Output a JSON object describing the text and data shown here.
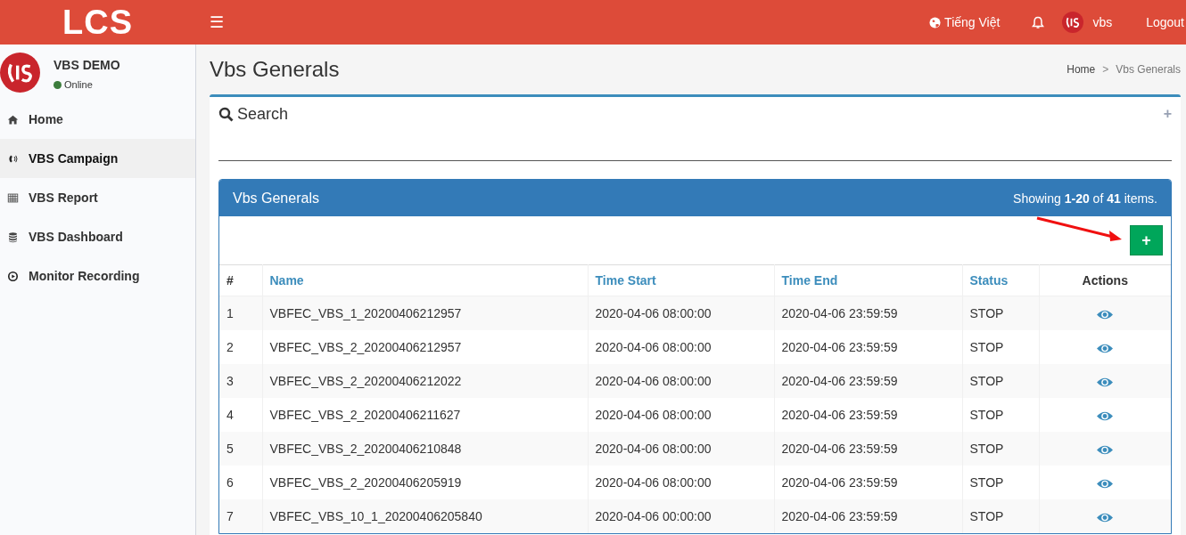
{
  "header": {
    "logo": "LCS",
    "menu_icon": "☰",
    "language": "Tiếng Việt",
    "user": "vbs",
    "logout": "Logout"
  },
  "sidebar": {
    "user_name": "VBS DEMO",
    "status": "Online",
    "items": [
      {
        "label": "Home",
        "selected": false
      },
      {
        "label": "VBS Campaign",
        "selected": true
      },
      {
        "label": "VBS Report",
        "selected": false
      },
      {
        "label": "VBS Dashboard",
        "selected": false
      },
      {
        "label": "Monitor Recording",
        "selected": false
      }
    ]
  },
  "page": {
    "title": "Vbs Generals",
    "breadcrumb": [
      {
        "label": "Home",
        "kind": "link"
      },
      {
        "label": "Vbs Generals",
        "kind": "current"
      }
    ],
    "breadcrumb_separator": ">"
  },
  "search_box": {
    "title": "Search",
    "toggle": "+"
  },
  "panel": {
    "title": "Vbs Generals",
    "summary": "Showing **1-20** of **41** items.",
    "add_button": "+"
  },
  "table": {
    "columns": [
      {
        "label": "#",
        "kind": "plain"
      },
      {
        "label": "Name",
        "kind": "sortable"
      },
      {
        "label": "Time Start",
        "kind": "sortable"
      },
      {
        "label": "Time End",
        "kind": "sortable"
      },
      {
        "label": "Status",
        "kind": "sortable"
      },
      {
        "label": "Actions",
        "kind": "center"
      }
    ],
    "rows": [
      [
        "1",
        "VBFEC_VBS_1_20200406212957",
        "2020-04-06 08:00:00",
        "2020-04-06 23:59:59",
        "STOP"
      ],
      [
        "2",
        "VBFEC_VBS_2_20200406212957",
        "2020-04-06 08:00:00",
        "2020-04-06 23:59:59",
        "STOP"
      ],
      [
        "3",
        "VBFEC_VBS_2_20200406212022",
        "2020-04-06 08:00:00",
        "2020-04-06 23:59:59",
        "STOP"
      ],
      [
        "4",
        "VBFEC_VBS_2_20200406211627",
        "2020-04-06 08:00:00",
        "2020-04-06 23:59:59",
        "STOP"
      ],
      [
        "5",
        "VBFEC_VBS_2_20200406210848",
        "2020-04-06 08:00:00",
        "2020-04-06 23:59:59",
        "STOP"
      ],
      [
        "6",
        "VBFEC_VBS_2_20200406205919",
        "2020-04-06 08:00:00",
        "2020-04-06 23:59:59",
        "STOP"
      ],
      [
        "7",
        "VBFEC_VBS_10_1_20200406205840",
        "2020-04-06 00:00:00",
        "2020-04-06 23:59:59",
        "STOP"
      ]
    ]
  }
}
